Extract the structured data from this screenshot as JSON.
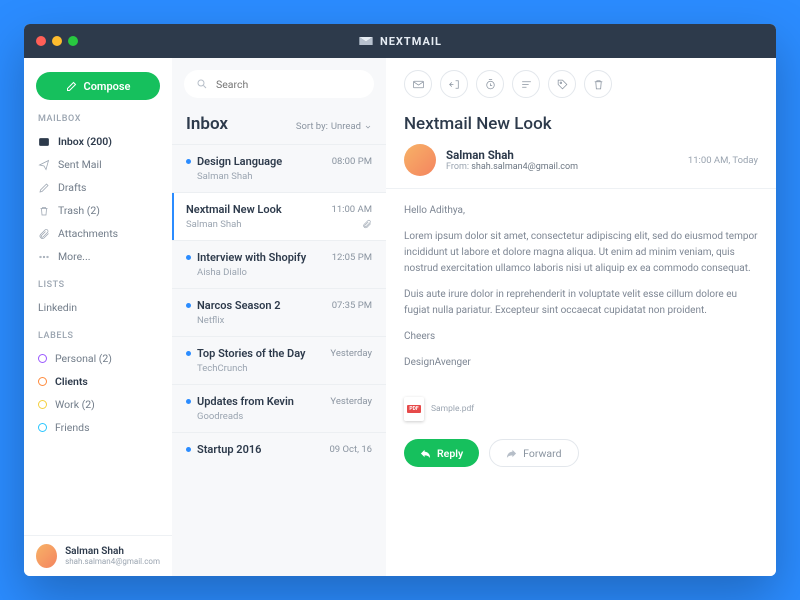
{
  "brand": "NEXTMAIL",
  "compose": "Compose",
  "sections": {
    "mailbox": "MAILBOX",
    "lists": "LISTS",
    "labels": "LABELS"
  },
  "nav": {
    "inbox": "Inbox (200)",
    "sent": "Sent Mail",
    "drafts": "Drafts",
    "trash": "Trash (2)",
    "attachments": "Attachments",
    "more": "More..."
  },
  "lists": {
    "linkedin": "Linkedin"
  },
  "labels": {
    "personal": {
      "text": "Personal (2)",
      "color": "#9b59ff"
    },
    "clients": {
      "text": "Clients",
      "color": "#ff8b3d"
    },
    "work": {
      "text": "Work (2)",
      "color": "#f4d03f"
    },
    "friends": {
      "text": "Friends",
      "color": "#2bc6ff"
    }
  },
  "profile": {
    "name": "Salman Shah",
    "email": "shah.salman4@gmail.com"
  },
  "search": {
    "placeholder": "Search"
  },
  "listTitle": "Inbox",
  "sortLabel": "Sort by:",
  "sortValue": "Unread",
  "messages": [
    {
      "subject": "Design Language",
      "from": "Salman Shah",
      "time": "08:00 PM",
      "unread": true
    },
    {
      "subject": "Nextmail New Look",
      "from": "Salman Shah",
      "time": "11:00 AM",
      "unread": false,
      "selected": true,
      "attach": true
    },
    {
      "subject": "Interview with Shopify",
      "from": "Aisha Diallo",
      "time": "12:05 PM",
      "unread": true
    },
    {
      "subject": "Narcos Season 2",
      "from": "Netflix",
      "time": "07:35 PM",
      "unread": true
    },
    {
      "subject": "Top Stories of the Day",
      "from": "TechCrunch",
      "time": "Yesterday",
      "unread": true
    },
    {
      "subject": "Updates from Kevin",
      "from": "Goodreads",
      "time": "Yesterday",
      "unread": true
    },
    {
      "subject": "Startup 2016",
      "from": "",
      "time": "09 Oct, 16",
      "unread": true
    }
  ],
  "mail": {
    "title": "Nextmail New Look",
    "sender": "Salman Shah",
    "fromLabel": "From:",
    "fromEmail": "shah.salman4@gmail.com",
    "time": "11:00 AM, Today",
    "greeting": "Hello Adithya,",
    "p1": "Lorem ipsum dolor sit amet, consectetur adipiscing elit, sed do eiusmod tempor incididunt ut labore et dolore magna aliqua. Ut enim ad minim veniam, quis nostrud exercitation ullamco laboris nisi ut aliquip ex ea commodo consequat.",
    "p2": "Duis aute irure dolor in reprehenderit in voluptate velit esse cillum dolore eu fugiat nulla pariatur. Excepteur sint occaecat cupidatat non proident.",
    "sign1": "Cheers",
    "sign2": "DesignAvenger",
    "attachment": "Sample.pdf",
    "reply": "Reply",
    "forward": "Forward"
  }
}
